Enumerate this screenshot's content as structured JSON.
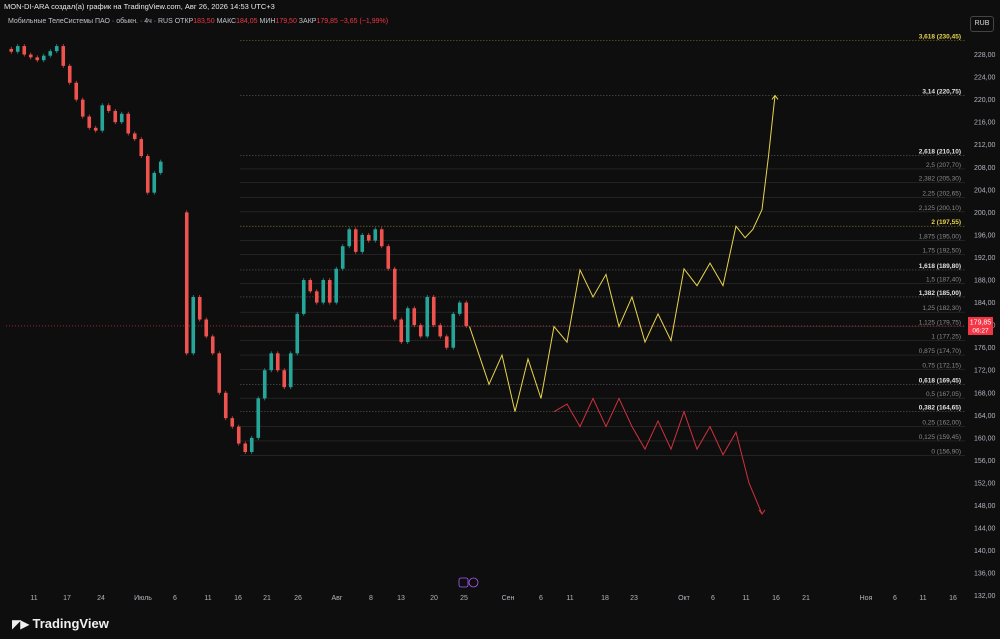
{
  "header": {
    "attribution": "MON-DI-ARA создал(а) график на TradingView.com, Авг 26, 2026 14:53 UTC+3"
  },
  "symbol": {
    "name": "Мобильные ТелеСистемы ПАО · обыкн. · 4ч · RUS",
    "open_label": "ОТКР",
    "open": "183,50",
    "high_label": "МАКС",
    "high": "184,05",
    "low_label": "МИН",
    "low": "179,50",
    "close_label": "ЗАКР",
    "close": "179,85",
    "change": "−3,65 (−1,99%)"
  },
  "currency": "RUB",
  "last_price": {
    "value": "179,85",
    "countdown": "06:27"
  },
  "logo": "TradingView",
  "chart_data": {
    "type": "line",
    "y_axis": {
      "range": [
        130,
        232
      ],
      "ticks": [
        132,
        136,
        140,
        144,
        148,
        152,
        156,
        160,
        164,
        168,
        172,
        176,
        180,
        184,
        188,
        192,
        196,
        200,
        204,
        208,
        212,
        216,
        220,
        224,
        228
      ],
      "currency": "RUB"
    },
    "x_axis": {
      "ticks": [
        "11",
        "17",
        "24",
        "Июль",
        "6",
        "11",
        "16",
        "21",
        "26",
        "Авг",
        "8",
        "13",
        "20",
        "25",
        "Сен",
        "6",
        "11",
        "18",
        "23",
        "Окт",
        "6",
        "11",
        "16",
        "21",
        "Ноя",
        "6",
        "11",
        "16"
      ]
    },
    "fib_levels": [
      {
        "ratio": "3,618",
        "price": 230.45,
        "label": "3,618 (230,45)",
        "color": "#e8d44d",
        "bold": true
      },
      {
        "ratio": "3,14",
        "price": 220.75,
        "label": "3,14 (220,75)",
        "color": "#e0e0e0",
        "bold": true
      },
      {
        "ratio": "2,618",
        "price": 210.1,
        "label": "2,618 (210,10)",
        "color": "#e0e0e0",
        "bold": true
      },
      {
        "ratio": "2,5",
        "price": 207.7,
        "label": "2,5 (207,70)",
        "color": "#8a8a8a",
        "bold": false
      },
      {
        "ratio": "2,382",
        "price": 205.3,
        "label": "2,382 (205,30)",
        "color": "#8a8a8a",
        "bold": false
      },
      {
        "ratio": "2,25",
        "price": 202.65,
        "label": "2,25 (202,65)",
        "color": "#8a8a8a",
        "bold": false
      },
      {
        "ratio": "2,125",
        "price": 200.1,
        "label": "2,125 (200,10)",
        "color": "#8a8a8a",
        "bold": false
      },
      {
        "ratio": "2",
        "price": 197.55,
        "label": "2 (197,55)",
        "color": "#e8d44d",
        "bold": true
      },
      {
        "ratio": "1,875",
        "price": 195.0,
        "label": "1,875 (195,00)",
        "color": "#8a8a8a",
        "bold": false
      },
      {
        "ratio": "1,75",
        "price": 192.5,
        "label": "1,75 (192,50)",
        "color": "#8a8a8a",
        "bold": false
      },
      {
        "ratio": "1,618",
        "price": 189.8,
        "label": "1,618 (189,80)",
        "color": "#e0e0e0",
        "bold": true
      },
      {
        "ratio": "1,5",
        "price": 187.4,
        "label": "1,5 (187,40)",
        "color": "#8a8a8a",
        "bold": false
      },
      {
        "ratio": "1,382",
        "price": 185.0,
        "label": "1,382 (185,00)",
        "color": "#e0e0e0",
        "bold": true
      },
      {
        "ratio": "1,25",
        "price": 182.3,
        "label": "1,25 (182,30)",
        "color": "#8a8a8a",
        "bold": false
      },
      {
        "ratio": "1,125",
        "price": 179.75,
        "label": "1,125 (179,75)",
        "color": "#8a8a8a",
        "bold": false
      },
      {
        "ratio": "1",
        "price": 177.25,
        "label": "1 (177,25)",
        "color": "#8a8a8a",
        "bold": false
      },
      {
        "ratio": "0,875",
        "price": 174.7,
        "label": "0,875 (174,70)",
        "color": "#8a8a8a",
        "bold": false
      },
      {
        "ratio": "0,75",
        "price": 172.15,
        "label": "0,75 (172,15)",
        "color": "#8a8a8a",
        "bold": false
      },
      {
        "ratio": "0,618",
        "price": 169.45,
        "label": "0,618 (169,45)",
        "color": "#e0e0e0",
        "bold": true
      },
      {
        "ratio": "0,5",
        "price": 167.05,
        "label": "0,5 (167,05)",
        "color": "#8a8a8a",
        "bold": false
      },
      {
        "ratio": "0,382",
        "price": 164.65,
        "label": "0,382 (164,65)",
        "color": "#e0e0e0",
        "bold": true
      },
      {
        "ratio": "0,25",
        "price": 162.0,
        "label": "0,25 (162,00)",
        "color": "#8a8a8a",
        "bold": false
      },
      {
        "ratio": "0,125",
        "price": 159.45,
        "label": "0,125 (159,45)",
        "color": "#8a8a8a",
        "bold": false
      },
      {
        "ratio": "0",
        "price": 156.9,
        "label": "0 (156,90)",
        "color": "#8a8a8a",
        "bold": false
      }
    ],
    "price_series": [
      [
        0,
        229
      ],
      [
        0.5,
        228.5
      ],
      [
        1,
        229.5
      ],
      [
        1.5,
        228
      ],
      [
        2,
        227.5
      ],
      [
        2.5,
        227
      ],
      [
        3,
        227.8
      ],
      [
        3.5,
        228.6
      ],
      [
        4,
        229.5
      ],
      [
        4.5,
        226
      ],
      [
        5,
        223
      ],
      [
        5.5,
        220
      ],
      [
        6,
        217
      ],
      [
        6.5,
        215
      ],
      [
        7,
        214.5
      ],
      [
        7.5,
        219
      ],
      [
        8,
        218
      ],
      [
        8.5,
        216
      ],
      [
        9,
        217.5
      ],
      [
        9.5,
        214
      ],
      [
        10,
        213
      ],
      [
        10.5,
        210
      ],
      [
        11,
        203.5
      ],
      [
        11.5,
        207
      ],
      [
        12,
        209
      ],
      [
        13.5,
        200
      ],
      [
        14,
        175
      ],
      [
        14.5,
        185
      ],
      [
        15,
        181
      ],
      [
        15.5,
        178
      ],
      [
        16,
        175
      ],
      [
        16.5,
        168
      ],
      [
        17,
        163.5
      ],
      [
        17.5,
        162
      ],
      [
        18,
        159
      ],
      [
        18.5,
        157.5
      ],
      [
        19,
        160
      ],
      [
        19.5,
        167
      ],
      [
        20,
        172
      ],
      [
        20.5,
        175
      ],
      [
        21,
        172
      ],
      [
        21.5,
        169
      ],
      [
        22,
        175
      ],
      [
        22.5,
        182
      ],
      [
        23,
        188
      ],
      [
        23.5,
        186
      ],
      [
        24,
        184
      ],
      [
        24.5,
        188
      ],
      [
        25,
        184
      ],
      [
        25.5,
        190
      ],
      [
        26,
        194
      ],
      [
        26.5,
        197
      ],
      [
        27,
        193
      ],
      [
        27.5,
        196
      ],
      [
        28,
        195
      ],
      [
        28.5,
        197
      ],
      [
        29,
        194
      ],
      [
        29.5,
        190
      ],
      [
        30,
        181
      ],
      [
        30.5,
        177
      ],
      [
        31,
        183
      ],
      [
        31.5,
        180
      ],
      [
        32,
        178
      ],
      [
        32.5,
        185
      ],
      [
        33,
        180
      ],
      [
        33.5,
        178
      ],
      [
        34,
        176
      ],
      [
        34.5,
        182
      ],
      [
        35,
        184
      ],
      [
        35.5,
        179.85
      ]
    ],
    "bullish_path": [
      [
        35.5,
        179.75
      ],
      [
        37,
        169.5
      ],
      [
        38,
        174.7
      ],
      [
        39,
        164.65
      ],
      [
        40,
        174
      ],
      [
        41,
        167
      ],
      [
        42,
        179.75
      ],
      [
        43,
        177
      ],
      [
        44,
        189.8
      ],
      [
        45,
        185
      ],
      [
        46,
        189
      ],
      [
        47,
        179.75
      ],
      [
        48,
        185
      ],
      [
        49,
        177
      ],
      [
        50,
        182
      ],
      [
        51,
        177.25
      ],
      [
        52,
        190
      ],
      [
        53,
        187
      ],
      [
        54,
        191
      ],
      [
        55,
        187
      ],
      [
        56,
        197.55
      ],
      [
        56.7,
        195.5
      ],
      [
        57.3,
        197
      ],
      [
        58,
        200.5
      ],
      [
        58.5,
        210
      ],
      [
        59,
        220.75
      ]
    ],
    "bearish_path": [
      [
        42,
        164.65
      ],
      [
        43,
        166
      ],
      [
        44,
        162
      ],
      [
        45,
        167
      ],
      [
        46,
        162
      ],
      [
        47,
        167
      ],
      [
        48,
        162
      ],
      [
        49,
        158
      ],
      [
        50,
        163
      ],
      [
        51,
        158
      ],
      [
        52,
        164.65
      ],
      [
        53,
        158
      ],
      [
        54,
        162
      ],
      [
        55,
        157
      ],
      [
        56,
        161
      ],
      [
        57,
        152
      ],
      [
        58,
        146.5
      ]
    ]
  }
}
